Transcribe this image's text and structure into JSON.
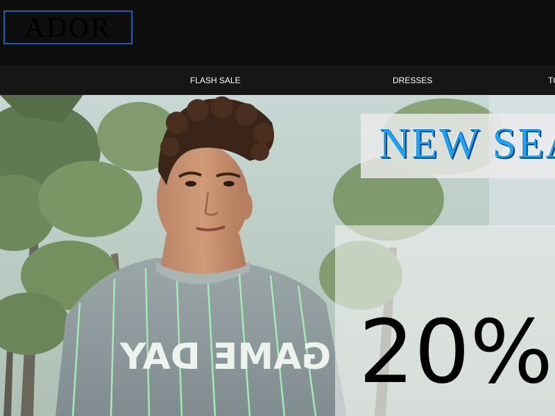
{
  "header": {
    "logo_text": "ADOR",
    "logo_border_color": "#1f5dbb"
  },
  "nav": {
    "items": [
      {
        "label": "FLASH SALE"
      },
      {
        "label": "DRESSES"
      },
      {
        "label": "TO"
      }
    ]
  },
  "hero": {
    "headline": "NEW SEA",
    "discount": "20%",
    "shirt_text": "GAME DAY",
    "headline_color": "#1ea3f3"
  }
}
